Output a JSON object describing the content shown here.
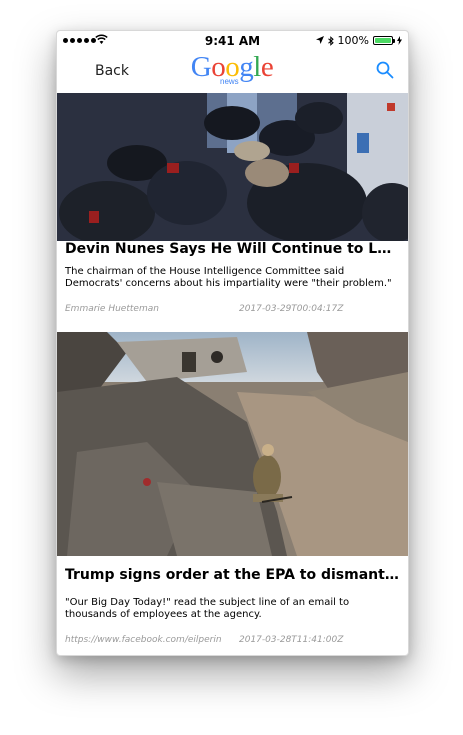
{
  "status_bar": {
    "time": "9:41 AM",
    "battery_text": "100%",
    "battery_level": 1.0
  },
  "nav": {
    "back_label": "Back",
    "logo_letters": [
      "G",
      "o",
      "o",
      "g",
      "l",
      "e"
    ],
    "logo_colors": [
      "#4285F4",
      "#EA4335",
      "#FBBC05",
      "#4285F4",
      "#34A853",
      "#EA4335"
    ],
    "logo_sub": "news",
    "search_icon": "search-icon",
    "accent_color": "#1a8cff"
  },
  "articles": [
    {
      "image_icon": "police-crowd-photo",
      "title": "Devin Nunes Says He Will Continue to Lead Russia Inquiry",
      "summary": "The chairman of the House Intelligence Committee said Democrats' concerns about his impartiality were \"their problem.\"",
      "source": "Emmarie Huetteman",
      "date": "2017-03-29T00:04:17Z"
    },
    {
      "image_icon": "rubble-photo",
      "title": "Trump signs order at the EPA to dismantle environmental protections",
      "summary": "\"Our Big Day Today!\" read the subject line of an email to thousands of employees at the agency.",
      "source": "https://www.facebook.com/eilperin",
      "date": "2017-03-28T11:41:00Z"
    }
  ]
}
